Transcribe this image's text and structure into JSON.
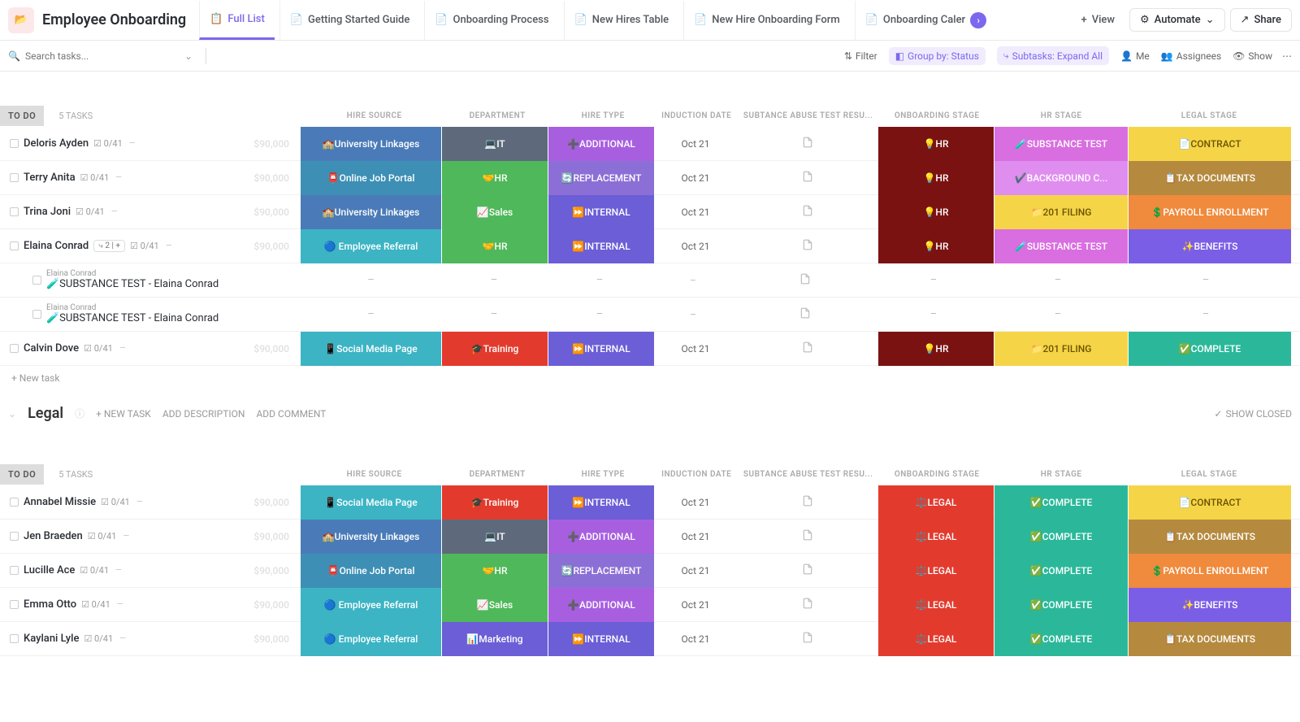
{
  "header": {
    "title": "Employee Onboarding",
    "tabs": [
      {
        "label": "Full List",
        "active": true
      },
      {
        "label": "Getting Started Guide"
      },
      {
        "label": "Onboarding Process"
      },
      {
        "label": "New Hires Table"
      },
      {
        "label": "New Hire Onboarding Form"
      },
      {
        "label": "Onboarding Caler"
      }
    ],
    "view_btn": "View",
    "automate_btn": "Automate",
    "share_btn": "Share"
  },
  "subbar": {
    "search_placeholder": "Search tasks...",
    "filter": "Filter",
    "group_by": "Group by: Status",
    "subtasks": "Subtasks: Expand All",
    "me": "Me",
    "assignees": "Assignees",
    "show": "Show"
  },
  "columns": {
    "hire_source": "HIRE SOURCE",
    "department": "DEPARTMENT",
    "hire_type": "HIRE TYPE",
    "induction": "INDUCTION DATE",
    "subtest": "SUBTANCE ABUSE TEST RESU...",
    "onboarding": "ONBOARDING STAGE",
    "hr_stage": "HR STAGE",
    "legal_stage": "LEGAL STAGE"
  },
  "group1": {
    "status": "TO DO",
    "count": "5 TASKS",
    "rows": [
      {
        "name": "Deloris Ayden",
        "tc": "0/41",
        "amt": "$90,000",
        "src": "🏫University Linkages",
        "src_c": "c-univ",
        "dep": "💻IT",
        "dep_c": "c-it",
        "ht": "➕ADDITIONAL",
        "ht_c": "c-add",
        "date": "Oct 21",
        "ob": "💡HR",
        "hr": "🧪SUBSTANCE TEST",
        "hr_c": "c-sub",
        "lg": "📄CONTRACT",
        "lg_c": "c-contract"
      },
      {
        "name": "Terry Anita",
        "tc": "0/41",
        "amt": "$90,000",
        "src": "📮Online Job Portal",
        "src_c": "c-portal",
        "dep": "🤝HR",
        "dep_c": "c-hr",
        "ht": "🔄REPLACEMENT",
        "ht_c": "c-repl",
        "date": "Oct 21",
        "ob": "💡HR",
        "hr": "✔️BACKGROUND C...",
        "hr_c": "c-bg",
        "lg": "📋TAX DOCUMENTS",
        "lg_c": "c-tax"
      },
      {
        "name": "Trina Joni",
        "tc": "0/41",
        "amt": "$90,000",
        "src": "🏫University Linkages",
        "src_c": "c-univ",
        "dep": "📈Sales",
        "dep_c": "c-sales",
        "ht": "⏩INTERNAL",
        "ht_c": "c-int",
        "date": "Oct 21",
        "ob": "💡HR",
        "hr": "📁201 FILING",
        "hr_c": "c-201",
        "lg": "💲PAYROLL ENROLLMENT",
        "lg_c": "c-payroll"
      },
      {
        "name": "Elaina Conrad",
        "tc": "0/41",
        "amt": "$90,000",
        "sub": " 2 ",
        "src": "🔵 Employee Referral",
        "src_c": "c-referral",
        "dep": "🤝HR",
        "dep_c": "c-hr",
        "ht": "⏩INTERNAL",
        "ht_c": "c-int",
        "date": "Oct 21",
        "ob": "💡HR",
        "hr": "🧪SUBSTANCE TEST",
        "hr_c": "c-sub",
        "lg": "✨BENEFITS",
        "lg_c": "c-benefits",
        "subtasks": [
          {
            "parent": "Elaina Conrad",
            "name": "🧪SUBSTANCE TEST - Elaina Conrad"
          },
          {
            "parent": "Elaina Conrad",
            "name": "🧪SUBSTANCE TEST - Elaina Conrad"
          }
        ]
      },
      {
        "name": "Calvin Dove",
        "tc": "0/41",
        "amt": "$90,000",
        "src": "📱Social Media Page",
        "src_c": "c-social",
        "dep": "🎓Training",
        "dep_c": "c-training",
        "ht": "⏩INTERNAL",
        "ht_c": "c-int",
        "date": "Oct 21",
        "ob": "💡HR",
        "hr": "📁201 FILING",
        "hr_c": "c-201",
        "lg": "✅COMPLETE",
        "lg_c": "c-done"
      }
    ],
    "new_task": "+ New task"
  },
  "section2": {
    "title": "Legal",
    "new_task": "+ NEW TASK",
    "add_desc": "ADD DESCRIPTION",
    "add_comment": "ADD COMMENT",
    "show_closed": "SHOW CLOSED"
  },
  "group2": {
    "status": "TO DO",
    "count": "5 TASKS",
    "rows": [
      {
        "name": "Annabel Missie",
        "tc": "0/41",
        "amt": "$90,000",
        "src": "📱Social Media Page",
        "src_c": "c-social",
        "dep": "🎓Training",
        "dep_c": "c-training",
        "ht": "⏩INTERNAL",
        "ht_c": "c-int",
        "date": "Oct 21",
        "ob": "⚖️LEGAL",
        "hr": "✅COMPLETE",
        "hr_c": "c-complete",
        "lg": "📄CONTRACT",
        "lg_c": "c-contract"
      },
      {
        "name": "Jen Braeden",
        "tc": "0/41",
        "amt": "$90,000",
        "src": "🏫University Linkages",
        "src_c": "c-univ",
        "dep": "💻IT",
        "dep_c": "c-it",
        "ht": "➕ADDITIONAL",
        "ht_c": "c-add",
        "date": "Oct 21",
        "ob": "⚖️LEGAL",
        "hr": "✅COMPLETE",
        "hr_c": "c-complete",
        "lg": "📋TAX DOCUMENTS",
        "lg_c": "c-tax"
      },
      {
        "name": "Lucille Ace",
        "tc": "0/41",
        "amt": "$90,000",
        "src": "📮Online Job Portal",
        "src_c": "c-portal",
        "dep": "🤝HR",
        "dep_c": "c-hr",
        "ht": "🔄REPLACEMENT",
        "ht_c": "c-repl",
        "date": "Oct 21",
        "ob": "⚖️LEGAL",
        "hr": "✅COMPLETE",
        "hr_c": "c-complete",
        "lg": "💲PAYROLL ENROLLMENT",
        "lg_c": "c-payroll"
      },
      {
        "name": "Emma Otto",
        "tc": "0/41",
        "amt": "$90,000",
        "src": "🔵 Employee Referral",
        "src_c": "c-referral",
        "dep": "📈Sales",
        "dep_c": "c-sales",
        "ht": "➕ADDITIONAL",
        "ht_c": "c-add",
        "date": "Oct 21",
        "ob": "⚖️LEGAL",
        "hr": "✅COMPLETE",
        "hr_c": "c-complete",
        "lg": "✨BENEFITS",
        "lg_c": "c-benefits"
      },
      {
        "name": "Kaylani Lyle",
        "tc": "0/41",
        "amt": "$90,000",
        "src": "🔵 Employee Referral",
        "src_c": "c-referral",
        "dep": "📊Marketing",
        "dep_c": "c-marketing",
        "ht": "⏩INTERNAL",
        "ht_c": "c-int",
        "date": "Oct 21",
        "ob": "⚖️LEGAL",
        "hr": "✅COMPLETE",
        "hr_c": "c-complete",
        "lg": "📋TAX DOCUMENTS",
        "lg_c": "c-tax"
      }
    ]
  }
}
